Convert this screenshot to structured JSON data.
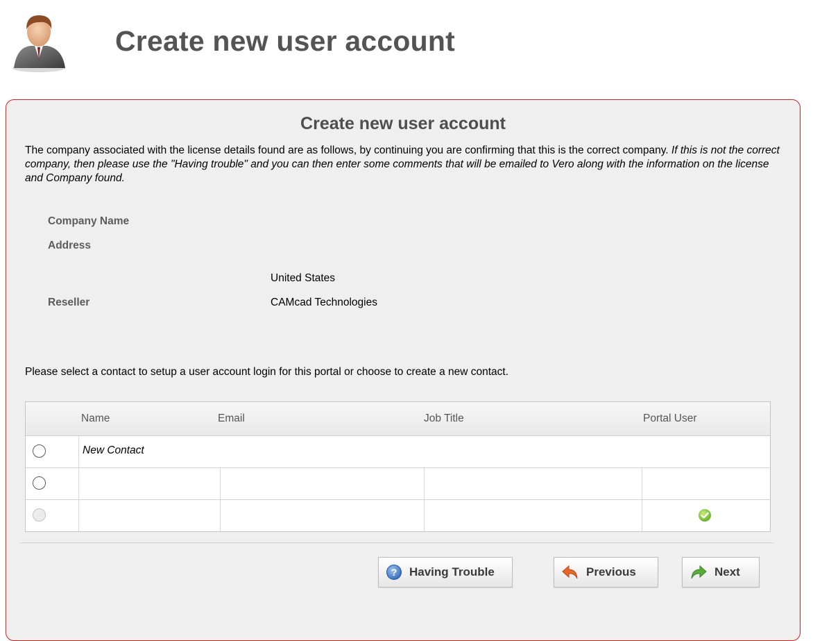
{
  "header": {
    "title": "Create new user account",
    "icon": "user-avatar-icon"
  },
  "panel": {
    "title": "Create new user account",
    "intro_normal": "The company associated with the license details found are as follows, by continuing you are confirming that this is the correct company. ",
    "intro_italic": "If this is not the correct company, then please use the \"Having trouble\" and you can then enter some comments that will be emailed to Vero along with the information on the license and Company found.",
    "details": {
      "company_name_label": "Company Name",
      "address_label": "Address",
      "country_value": "United States",
      "reseller_label": "Reseller",
      "reseller_value": "CAMcad Technologies"
    },
    "instruction": "Please select a contact to setup a user account login for this portal or choose to create a new contact."
  },
  "contacts_table": {
    "columns": [
      "Name",
      "Email",
      "Job Title",
      "Portal User"
    ],
    "rows": [
      {
        "name": "New Contact",
        "email": "",
        "job_title": "",
        "portal_user": false,
        "enabled": true
      },
      {
        "name": "",
        "email": "",
        "job_title": "",
        "portal_user": false,
        "enabled": true
      },
      {
        "name": "",
        "email": "",
        "job_title": "",
        "portal_user": true,
        "enabled": false
      }
    ]
  },
  "buttons": {
    "having_trouble": "Having Trouble",
    "previous": "Previous",
    "next": "Next"
  },
  "colors": {
    "panel_border": "#cc2222",
    "help_icon": "#3a79c9",
    "previous_arrow": "#e8672b",
    "next_arrow": "#58ad3c",
    "check_icon": "#6cbf2e"
  }
}
